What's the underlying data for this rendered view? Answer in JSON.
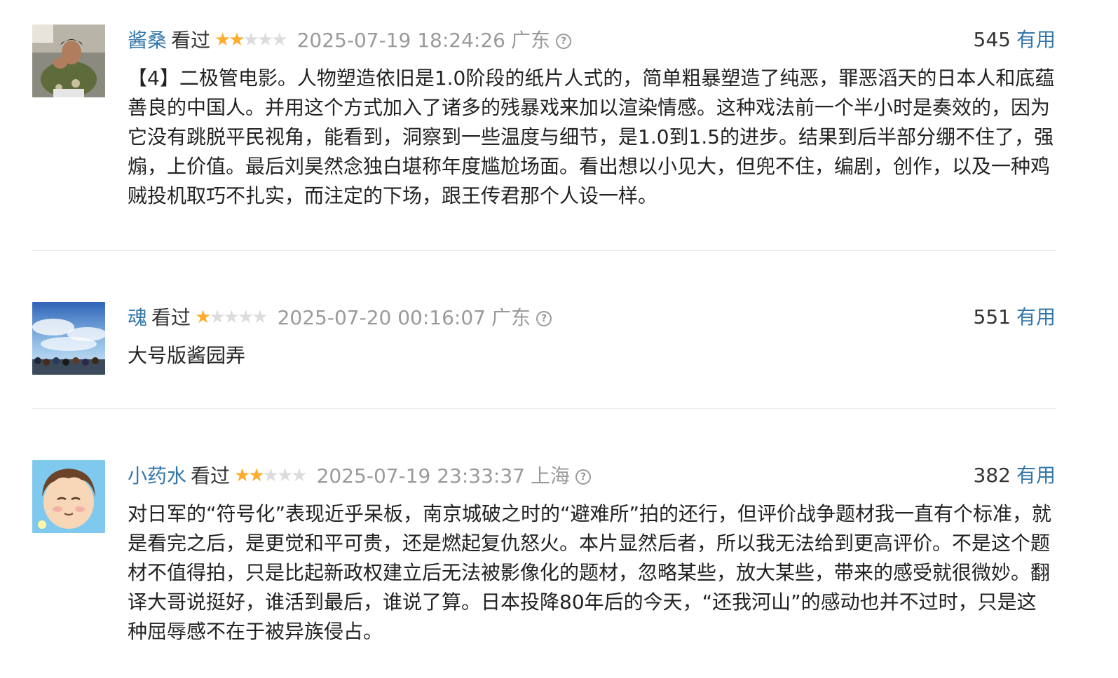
{
  "comments": [
    {
      "user": "酱桑",
      "status": "看过",
      "rating": 2,
      "time": "2025-07-19 18:24:26",
      "location": "广东",
      "votes": "545",
      "useful_label": "有用",
      "content": "【4】二极管电影。人物塑造依旧是1.0阶段的纸片人式的，简单粗暴塑造了纯恶，罪恶滔天的日本人和底蕴善良的中国人。并用这个方式加入了诸多的残暴戏来加以渲染情感。这种戏法前一个半小时是奏效的，因为它没有跳脱平民视角，能看到，洞察到一些温度与细节，是1.0到1.5的进步。结果到后半部分绷不住了，强煽，上价值。最后刘昊然念独白堪称年度尴尬场面。看出想以小见大，但兜不住，编剧，创作，以及一种鸡贼投机取巧不扎实，而注定的下场，跟王传君那个人设一样。"
    },
    {
      "user": "魂",
      "status": "看过",
      "rating": 1,
      "time": "2025-07-20 00:16:07",
      "location": "广东",
      "votes": "551",
      "useful_label": "有用",
      "content": "大号版酱园弄"
    },
    {
      "user": "小药水",
      "status": "看过",
      "rating": 2,
      "time": "2025-07-19 23:33:37",
      "location": "上海",
      "votes": "382",
      "useful_label": "有用",
      "content": "对日军的“符号化”表现近乎呆板，南京城破之时的“避难所”拍的还行，但评价战争题材我一直有个标准，就是看完之后，是更觉和平可贵，还是燃起复仇怒火。本片显然后者，所以我无法给到更高评价。不是这个题材不值得拍，只是比起新政权建立后无法被影像化的题材，忽略某些，放大某些，带来的感受就很微妙。翻译大哥说挺好，谁活到最后，谁说了算。日本投降80年后的今天，“还我河山”的感动也并不过时，只是这种屈辱感不在于被异族侵占。"
    }
  ],
  "icons": {
    "info": "info-icon",
    "star": "star-icon"
  },
  "colors": {
    "username": "#3377aa",
    "useful": "#3377aa",
    "star_on": "#ffac2d",
    "star_off": "#dcdcdc",
    "meta_gray": "#9a9a9a"
  }
}
